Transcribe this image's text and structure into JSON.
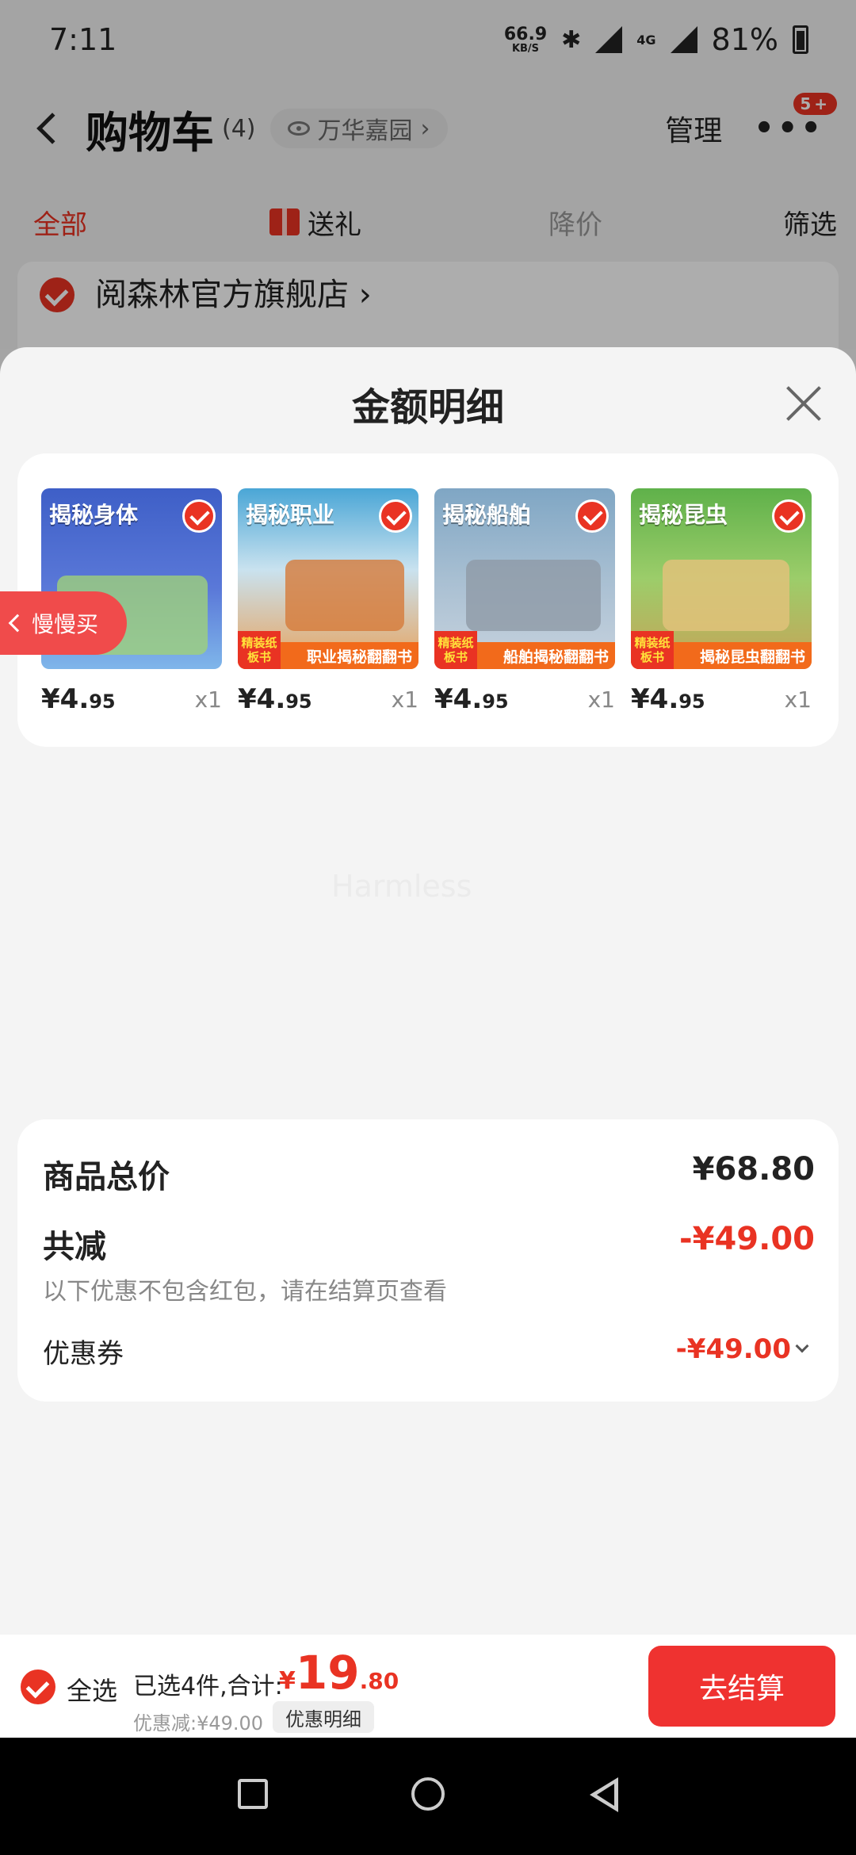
{
  "status_bar": {
    "time": "7:11",
    "net_speed": "66.9",
    "net_unit": "KB/S",
    "network": "4G",
    "battery": "81%"
  },
  "nav": {
    "title": "购物车",
    "count": "(4)",
    "location": "万华嘉园",
    "manage": "管理",
    "more": "•••",
    "badge": "5+"
  },
  "tabs": {
    "all": "全部",
    "gift": "送礼",
    "price_drop": "降价",
    "filter": "筛选"
  },
  "store": {
    "name": "阅森林官方旗舰店"
  },
  "sheet": {
    "title": "金额明细",
    "items": [
      {
        "cover": "揭秘身体",
        "band": "",
        "tag": "",
        "price_int": "¥4.",
        "price_dec": "95",
        "qty": "x1",
        "color_top": "#3e5fc7",
        "color_bottom": "#7fb6ea"
      },
      {
        "cover": "揭秘职业",
        "band": "职业揭秘翻翻书",
        "tag": "精装纸板书",
        "price_int": "¥4.",
        "price_dec": "95",
        "qty": "x1",
        "color_top": "#4aa6d6",
        "color_bottom": "#e8a15a"
      },
      {
        "cover": "揭秘船舶",
        "band": "船舶揭秘翻翻书",
        "tag": "精装纸板书",
        "price_int": "¥4.",
        "price_dec": "95",
        "qty": "x1",
        "color_top": "#7fa6c4",
        "color_bottom": "#c8d3de"
      },
      {
        "cover": "揭秘昆虫",
        "band": "揭秘昆虫翻翻书",
        "tag": "精装纸板书",
        "price_int": "¥4.",
        "price_dec": "95",
        "qty": "x1",
        "color_top": "#5fb14a",
        "color_bottom": "#c9a257"
      }
    ],
    "slow_buy": "慢慢买",
    "summary": {
      "total_label": "商品总价",
      "total_value": "¥68.80",
      "discount_label": "共减",
      "discount_value": "-¥49.00",
      "note": "以下优惠不包含红包，请在结算页查看",
      "coupon_label": "优惠券",
      "coupon_value": "-¥49.00"
    },
    "watermark": "Harmless"
  },
  "action_bar": {
    "select_all": "全选",
    "selected_text": "已选4件,合计:",
    "total_currency": "¥",
    "total_int": "19",
    "total_dec": ".80",
    "discount_text": "优惠减:¥49.00",
    "detail_button": "优惠明细",
    "checkout": "去结算"
  },
  "colors": {
    "accent": "#e93323",
    "checkout": "#ef3230"
  }
}
